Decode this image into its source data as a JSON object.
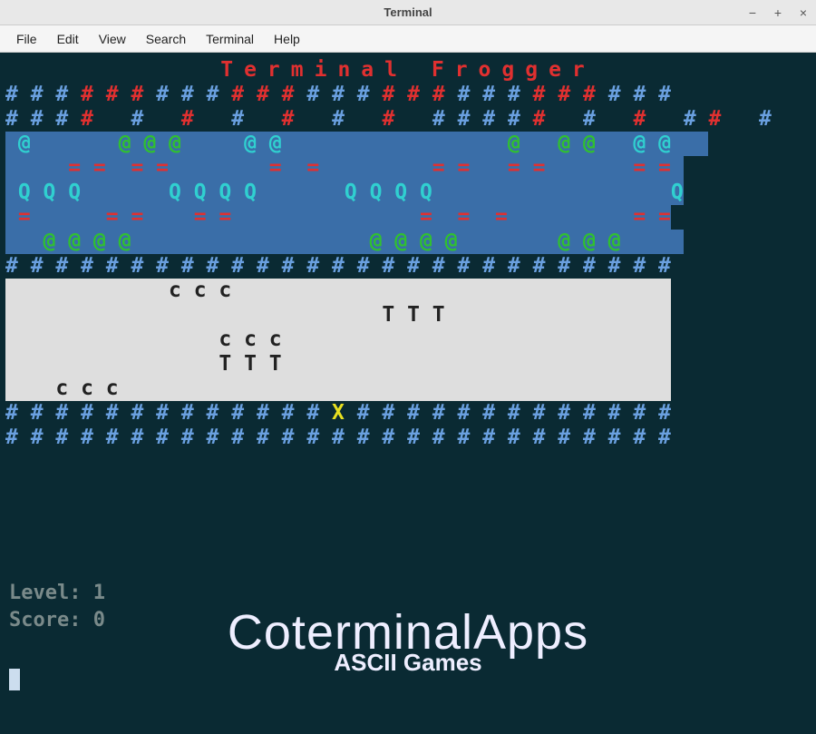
{
  "window": {
    "title": "Terminal",
    "controls": {
      "min": "−",
      "max": "+",
      "close": "×"
    }
  },
  "menubar": [
    "File",
    "Edit",
    "View",
    "Search",
    "Terminal",
    "Help"
  ],
  "game": {
    "title": "Terminal Frogger",
    "rows": [
      {
        "cls": "bg-black",
        "segments": [
          {
            "c": "c-blue",
            "t": "# # # "
          },
          {
            "c": "c-red",
            "t": "# # # "
          },
          {
            "c": "c-blue",
            "t": "# # # "
          },
          {
            "c": "c-red",
            "t": "# # # "
          },
          {
            "c": "c-blue",
            "t": "# # # "
          },
          {
            "c": "c-red",
            "t": "# # # "
          },
          {
            "c": "c-blue",
            "t": "# # # "
          },
          {
            "c": "c-red",
            "t": "# # # "
          },
          {
            "c": "c-blue",
            "t": "# # #"
          }
        ]
      },
      {
        "cls": "bg-black",
        "segments": [
          {
            "c": "c-blue",
            "t": "# # # "
          },
          {
            "c": "c-red",
            "t": "#   "
          },
          {
            "c": "c-blue",
            "t": "# "
          },
          {
            "c": "c-red",
            "t": "  #   "
          },
          {
            "c": "c-blue",
            "t": "# "
          },
          {
            "c": "c-red",
            "t": "  #   "
          },
          {
            "c": "c-blue",
            "t": "# "
          },
          {
            "c": "c-red",
            "t": "  #   "
          },
          {
            "c": "c-blue",
            "t": "# # # # "
          },
          {
            "c": "c-red",
            "t": "#   "
          },
          {
            "c": "c-blue",
            "t": "# "
          },
          {
            "c": "c-red",
            "t": "  #   "
          },
          {
            "c": "c-blue",
            "t": "# "
          },
          {
            "c": "c-red",
            "t": "#   "
          },
          {
            "c": "c-blue",
            "t": "#"
          }
        ]
      },
      {
        "cls": "bg-river",
        "segments": [
          {
            "c": "c-cyan",
            "t": " @       "
          },
          {
            "c": "c-green",
            "t": "@ @ @     "
          },
          {
            "c": "c-cyan",
            "t": "@ @                  "
          },
          {
            "c": "c-green",
            "t": "@   @ @   "
          },
          {
            "c": "c-cyan",
            "t": "@ @   "
          }
        ]
      },
      {
        "cls": "bg-river",
        "segments": [
          {
            "c": "c-red",
            "t": "     = =  = =        =  =         = =   = =       = = "
          }
        ]
      },
      {
        "cls": "bg-river",
        "segments": [
          {
            "c": "c-cyan",
            "t": " Q Q Q       Q Q Q Q       Q Q Q Q                   Q"
          }
        ]
      },
      {
        "cls": "bg-river",
        "segments": [
          {
            "c": "c-red",
            "t": " =      = =    = =               =  =  =          = ="
          }
        ]
      },
      {
        "cls": "bg-river",
        "segments": [
          {
            "c": "c-green",
            "t": "   @ @ @ @                   @ @ @ @        @ @ @     "
          }
        ]
      },
      {
        "cls": "bg-black",
        "segments": [
          {
            "c": "c-blue",
            "t": "# # # # # # # # # # # # # # # # # # # # # # # # # # #"
          }
        ]
      },
      {
        "cls": "bg-road",
        "segments": [
          {
            "c": "c-black",
            "t": "             c c c                                   "
          }
        ]
      },
      {
        "cls": "bg-road",
        "segments": [
          {
            "c": "c-black",
            "t": "                              T T T                  "
          }
        ]
      },
      {
        "cls": "bg-road",
        "segments": [
          {
            "c": "c-black",
            "t": "                 c c c                               "
          }
        ]
      },
      {
        "cls": "bg-road",
        "segments": [
          {
            "c": "c-black",
            "t": "                 T T T                               "
          }
        ]
      },
      {
        "cls": "bg-road",
        "segments": [
          {
            "c": "c-black",
            "t": "    c c c                                            "
          }
        ]
      },
      {
        "cls": "bg-black",
        "segments": [
          {
            "c": "c-blue",
            "t": "# # # # # # # # # # # # # "
          },
          {
            "c": "c-yellow",
            "t": "X"
          },
          {
            "c": "c-blue",
            "t": " # # # # # # # # # # # # #"
          }
        ]
      },
      {
        "cls": "bg-black",
        "segments": [
          {
            "c": "c-blue",
            "t": "# # # # # # # # # # # # # # # # # # # # # # # # # # #"
          }
        ]
      }
    ]
  },
  "stats": {
    "level_label": "Level:",
    "level_value": "1",
    "score_label": "Score:",
    "score_value": "0"
  },
  "brand": {
    "name": "CoterminalApps",
    "subtitle": "ASCII Games"
  }
}
